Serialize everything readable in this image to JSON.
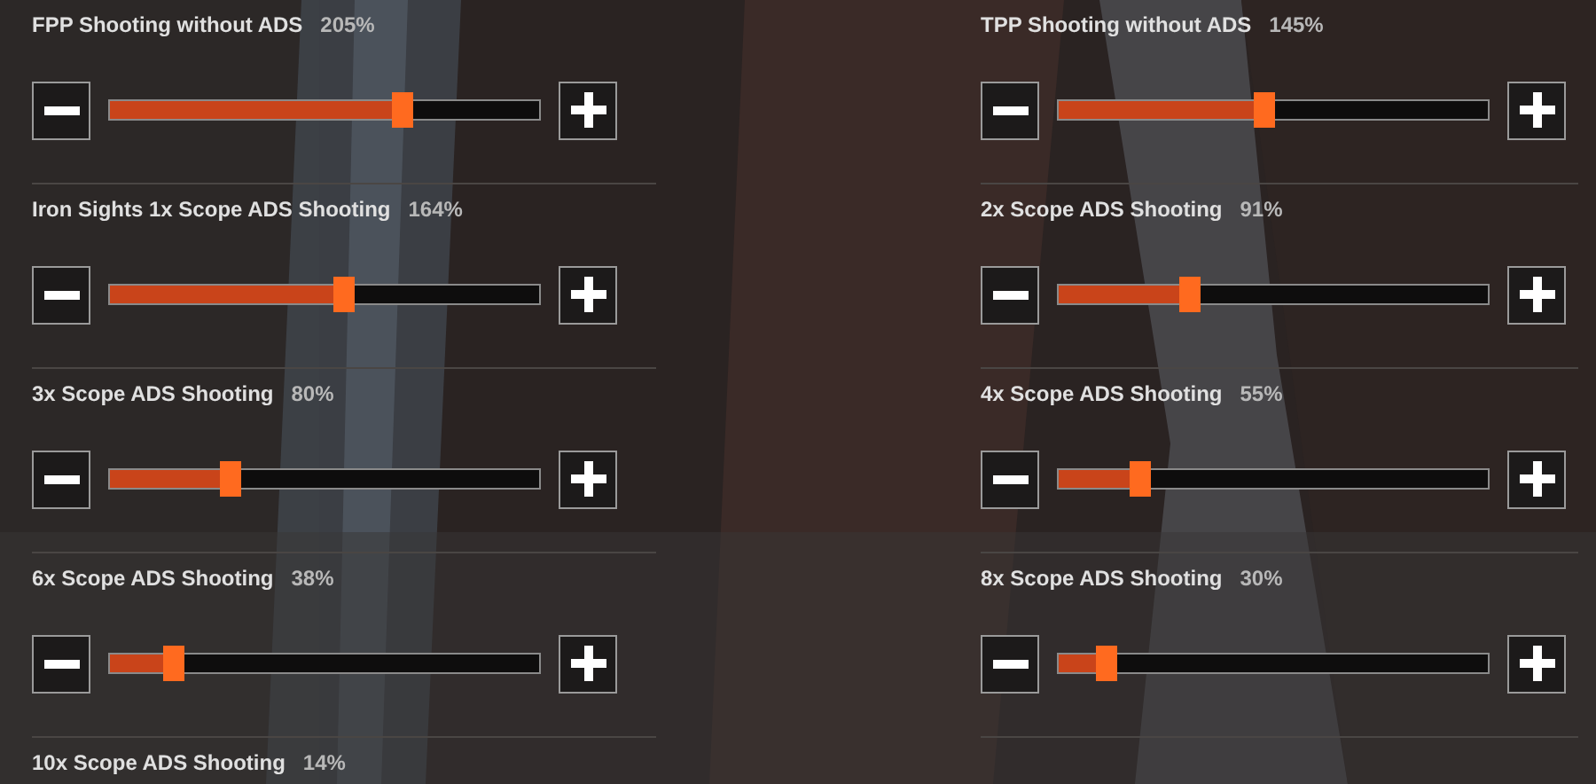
{
  "settings": [
    {
      "label": "FPP Shooting without ADS",
      "value": "205%",
      "level": 0.68
    },
    {
      "label": "TPP Shooting without ADS",
      "value": "145%",
      "level": 0.48
    },
    {
      "label": "Iron Sights 1x Scope ADS Shooting",
      "value": "164%",
      "level": 0.545
    },
    {
      "label": "2x Scope ADS Shooting",
      "value": "91%",
      "level": 0.305
    },
    {
      "label": "3x Scope ADS Shooting",
      "value": "80%",
      "level": 0.28
    },
    {
      "label": "4x Scope ADS Shooting",
      "value": "55%",
      "level": 0.19
    },
    {
      "label": "6x Scope ADS Shooting",
      "value": "38%",
      "level": 0.15
    },
    {
      "label": "8x Scope ADS Shooting",
      "value": "30%",
      "level": 0.11
    },
    {
      "label": "10x Scope ADS Shooting",
      "value": "14%"
    }
  ]
}
